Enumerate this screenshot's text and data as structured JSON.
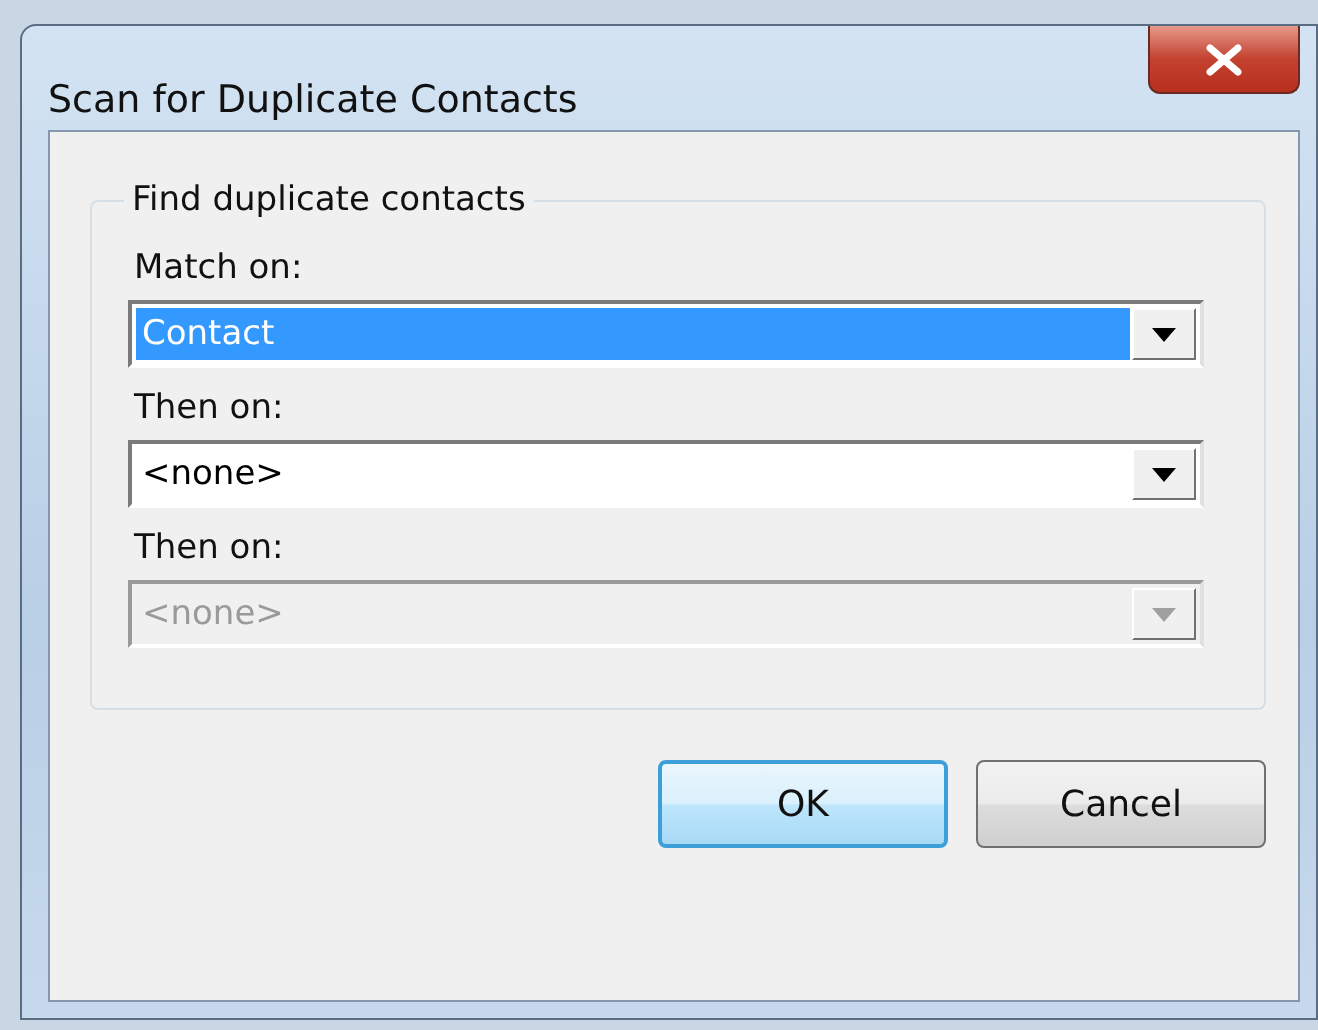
{
  "window": {
    "title": "Scan for Duplicate Contacts"
  },
  "group": {
    "legend": "Find duplicate contacts"
  },
  "fields": [
    {
      "label": "Match on:",
      "value": "Contact",
      "highlighted": true,
      "disabled": false
    },
    {
      "label": "Then on:",
      "value": "<none>",
      "highlighted": false,
      "disabled": false
    },
    {
      "label": "Then on:",
      "value": "<none>",
      "highlighted": false,
      "disabled": true
    }
  ],
  "buttons": [
    {
      "label": "OK",
      "default": true
    },
    {
      "label": "Cancel",
      "default": false
    }
  ]
}
